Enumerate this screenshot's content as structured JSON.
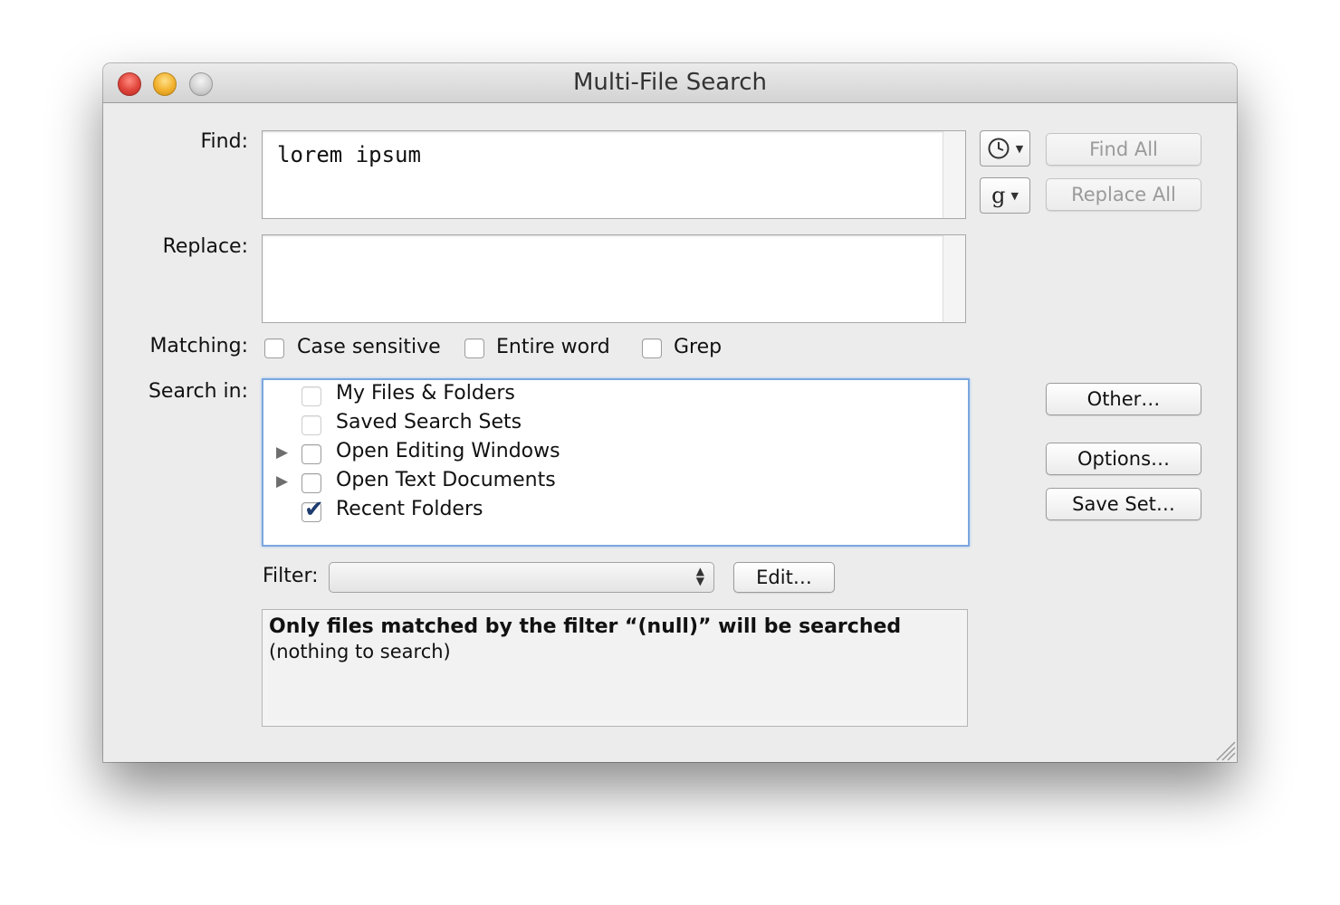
{
  "window": {
    "title": "Multi-File Search"
  },
  "find": {
    "label": "Find:",
    "value": "lorem ipsum",
    "history_icon": "clock-icon",
    "grep_icon_label": "g"
  },
  "replace": {
    "label": "Replace:",
    "value": ""
  },
  "buttons": {
    "find_all": "Find All",
    "replace_all": "Replace All",
    "other": "Other…",
    "options": "Options…",
    "save_set": "Save Set…",
    "edit": "Edit…"
  },
  "matching": {
    "label": "Matching:",
    "options": [
      {
        "label": "Case sensitive",
        "checked": false
      },
      {
        "label": "Entire word",
        "checked": false
      },
      {
        "label": "Grep",
        "checked": false
      }
    ]
  },
  "search_in": {
    "label": "Search in:",
    "items": [
      {
        "label": "My Files & Folders",
        "checked": false,
        "expandable": false
      },
      {
        "label": "Saved Search Sets",
        "checked": false,
        "expandable": false
      },
      {
        "label": "Open Editing Windows",
        "checked": false,
        "expandable": true
      },
      {
        "label": "Open Text Documents",
        "checked": false,
        "expandable": true
      },
      {
        "label": "Recent Folders",
        "checked": true,
        "expandable": false
      }
    ]
  },
  "filter": {
    "label": "Filter:",
    "selected": ""
  },
  "note": {
    "bold": "Only files matched by the filter “(null)” will be searched",
    "plain": "(nothing to search)"
  }
}
